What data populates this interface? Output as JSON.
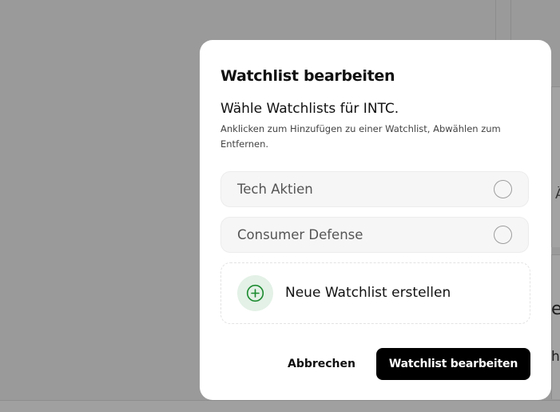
{
  "background": {
    "fragment_1": "Ä",
    "fragment_2": "el",
    "fragment_3": "hi"
  },
  "modal": {
    "title": "Watchlist bearbeiten",
    "subtitle": "Wähle Watchlists für INTC.",
    "hint": "Anklicken zum Hinzufügen zu einer Watchlist, Abwählen zum Entfernen.",
    "watchlists": [
      {
        "label": "Tech Aktien",
        "selected": false
      },
      {
        "label": "Consumer Defense",
        "selected": false
      }
    ],
    "create_label": "Neue Watchlist erstellen",
    "create_icon": "plus-circle-icon",
    "cancel_label": "Abbrechen",
    "submit_label": "Watchlist bearbeiten"
  },
  "colors": {
    "overlay": "#9a9a9a",
    "primary_button": "#000000",
    "accent_green": "#1a8a2e",
    "accent_green_bg": "#e3f1e6"
  }
}
